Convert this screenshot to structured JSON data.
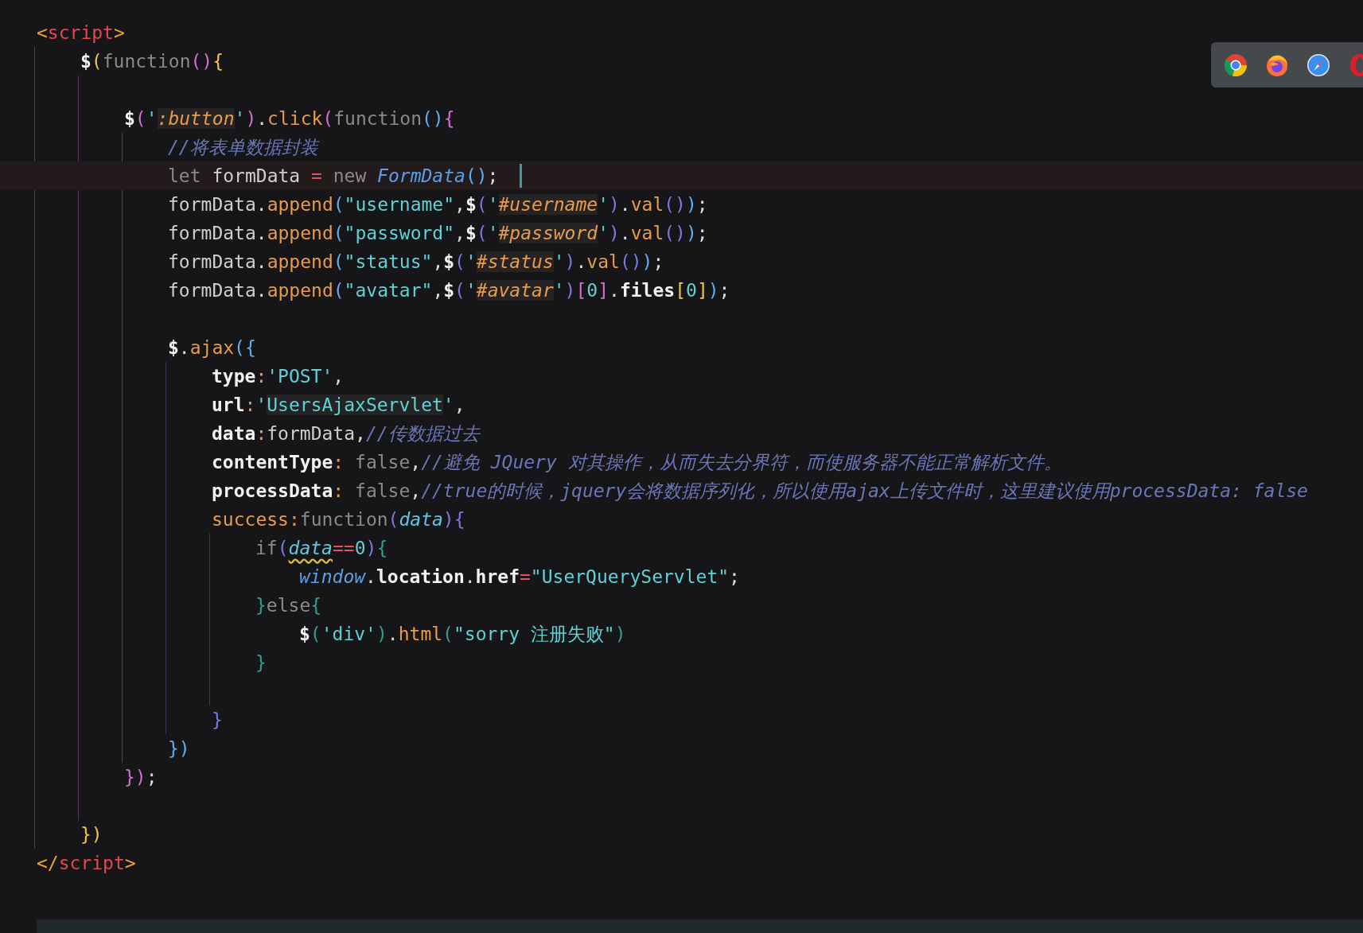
{
  "editor": {
    "lines": [
      {
        "current": false,
        "tokens": [
          {
            "text": "<",
            "kind": "angle"
          },
          {
            "text": "script",
            "kind": "tag"
          },
          {
            "text": ">",
            "kind": "angle"
          }
        ],
        "children": [
          {
            "current": false,
            "tokens": [
              {
                "text": "$",
                "kind": "dollar"
              },
              {
                "text": "(",
                "kind": "bracket",
                "color": "#f2c744"
              },
              {
                "text": "function",
                "kind": "keyword"
              },
              {
                "text": "()",
                "kind": "bracket",
                "color": "#d66ed6"
              },
              {
                "text": "{",
                "kind": "bracket",
                "color": "#f2c744"
              }
            ],
            "children": [
              {
                "current": false
              },
              {
                "current": false,
                "tokens": [
                  {
                    "text": "$",
                    "kind": "dollar"
                  },
                  {
                    "text": "(",
                    "kind": "bracket",
                    "color": "#d66ed6"
                  },
                  {
                    "text": "'",
                    "kind": "quote"
                  },
                  {
                    "text": ":button",
                    "kind": "selector"
                  },
                  {
                    "text": "'",
                    "kind": "quote"
                  },
                  {
                    "text": ")",
                    "kind": "bracket",
                    "color": "#d66ed6"
                  },
                  {
                    "text": ".",
                    "kind": "punct"
                  },
                  {
                    "text": "click",
                    "kind": "method"
                  },
                  {
                    "text": "(",
                    "kind": "bracket",
                    "color": "#d66ed6"
                  },
                  {
                    "text": "function",
                    "kind": "keyword"
                  },
                  {
                    "text": "()",
                    "kind": "bracket",
                    "color": "#5fb0f0"
                  },
                  {
                    "text": "{",
                    "kind": "bracket",
                    "color": "#d66ed6"
                  }
                ],
                "children": [
                  {
                    "current": false,
                    "tokens": [
                      {
                        "text": "//将表单数据封装",
                        "kind": "comment"
                      }
                    ]
                  },
                  {
                    "current": true,
                    "tokens": [
                      {
                        "text": "let ",
                        "kind": "keyword"
                      },
                      {
                        "text": "formData ",
                        "kind": "plain"
                      },
                      {
                        "text": "= ",
                        "kind": "operator"
                      },
                      {
                        "text": "new ",
                        "kind": "keyword"
                      },
                      {
                        "text": "FormData",
                        "kind": "class"
                      },
                      {
                        "text": "()",
                        "kind": "bracket",
                        "color": "#5fb0f0"
                      },
                      {
                        "text": ";",
                        "kind": "punct"
                      }
                    ]
                  },
                  {
                    "current": false,
                    "tokens": [
                      {
                        "text": "formData",
                        "kind": "plain"
                      },
                      {
                        "text": ".",
                        "kind": "punct"
                      },
                      {
                        "text": "append",
                        "kind": "method"
                      },
                      {
                        "text": "(",
                        "kind": "bracket",
                        "color": "#5fb0f0"
                      },
                      {
                        "text": "\"username\"",
                        "kind": "string"
                      },
                      {
                        "text": ",",
                        "kind": "punct"
                      },
                      {
                        "text": "$",
                        "kind": "dollar"
                      },
                      {
                        "text": "(",
                        "kind": "bracket",
                        "color": "#7a7ae6"
                      },
                      {
                        "text": "'",
                        "kind": "quote"
                      },
                      {
                        "text": "#username",
                        "kind": "selector"
                      },
                      {
                        "text": "'",
                        "kind": "quote"
                      },
                      {
                        "text": ")",
                        "kind": "bracket",
                        "color": "#7a7ae6"
                      },
                      {
                        "text": ".",
                        "kind": "punct"
                      },
                      {
                        "text": "val",
                        "kind": "method"
                      },
                      {
                        "text": "()",
                        "kind": "bracket",
                        "color": "#7a7ae6"
                      },
                      {
                        "text": ")",
                        "kind": "bracket",
                        "color": "#5fb0f0"
                      },
                      {
                        "text": ";",
                        "kind": "punct"
                      }
                    ]
                  },
                  {
                    "current": false,
                    "tokens": [
                      {
                        "text": "formData",
                        "kind": "plain"
                      },
                      {
                        "text": ".",
                        "kind": "punct"
                      },
                      {
                        "text": "append",
                        "kind": "method"
                      },
                      {
                        "text": "(",
                        "kind": "bracket",
                        "color": "#5fb0f0"
                      },
                      {
                        "text": "\"password\"",
                        "kind": "string"
                      },
                      {
                        "text": ",",
                        "kind": "punct"
                      },
                      {
                        "text": "$",
                        "kind": "dollar"
                      },
                      {
                        "text": "(",
                        "kind": "bracket",
                        "color": "#7a7ae6"
                      },
                      {
                        "text": "'",
                        "kind": "quote"
                      },
                      {
                        "text": "#password",
                        "kind": "selector"
                      },
                      {
                        "text": "'",
                        "kind": "quote"
                      },
                      {
                        "text": ")",
                        "kind": "bracket",
                        "color": "#7a7ae6"
                      },
                      {
                        "text": ".",
                        "kind": "punct"
                      },
                      {
                        "text": "val",
                        "kind": "method"
                      },
                      {
                        "text": "()",
                        "kind": "bracket",
                        "color": "#7a7ae6"
                      },
                      {
                        "text": ")",
                        "kind": "bracket",
                        "color": "#5fb0f0"
                      },
                      {
                        "text": ";",
                        "kind": "punct"
                      }
                    ]
                  },
                  {
                    "current": false,
                    "tokens": [
                      {
                        "text": "formData",
                        "kind": "plain"
                      },
                      {
                        "text": ".",
                        "kind": "punct"
                      },
                      {
                        "text": "append",
                        "kind": "method"
                      },
                      {
                        "text": "(",
                        "kind": "bracket",
                        "color": "#5fb0f0"
                      },
                      {
                        "text": "\"status\"",
                        "kind": "string"
                      },
                      {
                        "text": ",",
                        "kind": "punct"
                      },
                      {
                        "text": "$",
                        "kind": "dollar"
                      },
                      {
                        "text": "(",
                        "kind": "bracket",
                        "color": "#7a7ae6"
                      },
                      {
                        "text": "'",
                        "kind": "quote"
                      },
                      {
                        "text": "#status",
                        "kind": "selector"
                      },
                      {
                        "text": "'",
                        "kind": "quote"
                      },
                      {
                        "text": ")",
                        "kind": "bracket",
                        "color": "#7a7ae6"
                      },
                      {
                        "text": ".",
                        "kind": "punct"
                      },
                      {
                        "text": "val",
                        "kind": "method"
                      },
                      {
                        "text": "()",
                        "kind": "bracket",
                        "color": "#7a7ae6"
                      },
                      {
                        "text": ")",
                        "kind": "bracket",
                        "color": "#5fb0f0"
                      },
                      {
                        "text": ";",
                        "kind": "punct"
                      }
                    ]
                  },
                  {
                    "current": false,
                    "tokens": [
                      {
                        "text": "formData",
                        "kind": "plain"
                      },
                      {
                        "text": ".",
                        "kind": "punct"
                      },
                      {
                        "text": "append",
                        "kind": "method"
                      },
                      {
                        "text": "(",
                        "kind": "bracket",
                        "color": "#5fb0f0"
                      },
                      {
                        "text": "\"avatar\"",
                        "kind": "string"
                      },
                      {
                        "text": ",",
                        "kind": "punct"
                      },
                      {
                        "text": "$",
                        "kind": "dollar"
                      },
                      {
                        "text": "(",
                        "kind": "bracket",
                        "color": "#7a7ae6"
                      },
                      {
                        "text": "'",
                        "kind": "quote"
                      },
                      {
                        "text": "#avatar",
                        "kind": "selector"
                      },
                      {
                        "text": "'",
                        "kind": "quote"
                      },
                      {
                        "text": ")",
                        "kind": "bracket",
                        "color": "#7a7ae6"
                      },
                      {
                        "text": "[",
                        "kind": "bracket",
                        "color": "#d66ed6"
                      },
                      {
                        "text": "0",
                        "kind": "number"
                      },
                      {
                        "text": "]",
                        "kind": "bracket",
                        "color": "#d66ed6"
                      },
                      {
                        "text": ".",
                        "kind": "punct"
                      },
                      {
                        "text": "files",
                        "kind": "property"
                      },
                      {
                        "text": "[",
                        "kind": "bracket",
                        "color": "#f2c744"
                      },
                      {
                        "text": "0",
                        "kind": "number"
                      },
                      {
                        "text": "]",
                        "kind": "bracket",
                        "color": "#f2c744"
                      },
                      {
                        "text": ")",
                        "kind": "bracket",
                        "color": "#5fb0f0"
                      },
                      {
                        "text": ";",
                        "kind": "punct"
                      }
                    ]
                  },
                  {
                    "current": false
                  },
                  {
                    "current": false,
                    "tokens": [
                      {
                        "text": "$",
                        "kind": "dollar"
                      },
                      {
                        "text": ".",
                        "kind": "punct"
                      },
                      {
                        "text": "ajax",
                        "kind": "method"
                      },
                      {
                        "text": "(",
                        "kind": "bracket",
                        "color": "#5fb0f0"
                      },
                      {
                        "text": "{",
                        "kind": "bracket",
                        "color": "#5fb0f0"
                      }
                    ],
                    "children": [
                      {
                        "current": false,
                        "tokens": [
                          {
                            "text": "type",
                            "kind": "property"
                          },
                          {
                            "text": ":",
                            "kind": "colon"
                          },
                          {
                            "text": "'POST'",
                            "kind": "string"
                          },
                          {
                            "text": ",",
                            "kind": "punct"
                          }
                        ]
                      },
                      {
                        "current": false,
                        "tokens": [
                          {
                            "text": "url",
                            "kind": "property"
                          },
                          {
                            "text": ":",
                            "kind": "colon"
                          },
                          {
                            "text": "'",
                            "kind": "string"
                          },
                          {
                            "text": "UsersAjaxServlet",
                            "kind": "string-marked"
                          },
                          {
                            "text": "'",
                            "kind": "string"
                          },
                          {
                            "text": ",",
                            "kind": "punct"
                          }
                        ]
                      },
                      {
                        "current": false,
                        "tokens": [
                          {
                            "text": "data",
                            "kind": "property"
                          },
                          {
                            "text": ":",
                            "kind": "colon"
                          },
                          {
                            "text": "formData",
                            "kind": "plain"
                          },
                          {
                            "text": ",",
                            "kind": "punct"
                          },
                          {
                            "text": "//传数据过去",
                            "kind": "comment"
                          }
                        ]
                      },
                      {
                        "current": false,
                        "tokens": [
                          {
                            "text": "contentType",
                            "kind": "property"
                          },
                          {
                            "text": ": ",
                            "kind": "colon"
                          },
                          {
                            "text": "false",
                            "kind": "keyword"
                          },
                          {
                            "text": ",",
                            "kind": "punct"
                          },
                          {
                            "text": "//避免 JQuery 对其操作，从而失去分界符，而使服务器不能正常解析文件。",
                            "kind": "comment"
                          }
                        ]
                      },
                      {
                        "current": false,
                        "tokens": [
                          {
                            "text": "processData",
                            "kind": "property"
                          },
                          {
                            "text": ": ",
                            "kind": "colon"
                          },
                          {
                            "text": "false",
                            "kind": "keyword"
                          },
                          {
                            "text": ",",
                            "kind": "punct"
                          },
                          {
                            "text": "//true的时候，jquery会将数据序列化，所以使用ajax上传文件时，这里建议使用processData: false",
                            "kind": "comment"
                          }
                        ]
                      },
                      {
                        "current": false,
                        "tokens": [
                          {
                            "text": "success",
                            "kind": "method"
                          },
                          {
                            "text": ":",
                            "kind": "colon"
                          },
                          {
                            "text": "function",
                            "kind": "keyword"
                          },
                          {
                            "text": "(",
                            "kind": "bracket",
                            "color": "#7a7ae6"
                          },
                          {
                            "text": "data",
                            "kind": "param"
                          },
                          {
                            "text": ")",
                            "kind": "bracket",
                            "color": "#7a7ae6"
                          },
                          {
                            "text": "{",
                            "kind": "bracket",
                            "color": "#7a7ae6"
                          }
                        ],
                        "children": [
                          {
                            "current": false,
                            "tokens": [
                              {
                                "text": "if",
                                "kind": "keyword"
                              },
                              {
                                "text": "(",
                                "kind": "bracket",
                                "color": "#7a7ae6"
                              },
                              {
                                "text": "data",
                                "kind": "warning"
                              },
                              {
                                "text": "==",
                                "kind": "operator"
                              },
                              {
                                "text": "0",
                                "kind": "number"
                              },
                              {
                                "text": ")",
                                "kind": "bracket",
                                "color": "#7a7ae6"
                              },
                              {
                                "text": "{",
                                "kind": "bracket",
                                "color": "#2fa08c"
                              }
                            ],
                            "children": [
                              {
                                "current": false,
                                "tokens": [
                                  {
                                    "text": "window",
                                    "kind": "class"
                                  },
                                  {
                                    "text": ".",
                                    "kind": "punct"
                                  },
                                  {
                                    "text": "location",
                                    "kind": "property"
                                  },
                                  {
                                    "text": ".",
                                    "kind": "punct"
                                  },
                                  {
                                    "text": "href",
                                    "kind": "property"
                                  },
                                  {
                                    "text": "=",
                                    "kind": "operator"
                                  },
                                  {
                                    "text": "\"UserQueryServlet\"",
                                    "kind": "string"
                                  },
                                  {
                                    "text": ";",
                                    "kind": "punct"
                                  }
                                ]
                              }
                            ]
                          },
                          {
                            "current": false,
                            "tokens": [
                              {
                                "text": "}",
                                "kind": "bracket",
                                "color": "#2fa08c"
                              },
                              {
                                "text": "else",
                                "kind": "keyword"
                              },
                              {
                                "text": "{",
                                "kind": "bracket",
                                "color": "#2fa08c"
                              }
                            ],
                            "children": [
                              {
                                "current": false,
                                "tokens": [
                                  {
                                    "text": "$",
                                    "kind": "dollar"
                                  },
                                  {
                                    "text": "(",
                                    "kind": "bracket",
                                    "color": "#2fa08c"
                                  },
                                  {
                                    "text": "'div'",
                                    "kind": "string"
                                  },
                                  {
                                    "text": ")",
                                    "kind": "bracket",
                                    "color": "#2fa08c"
                                  },
                                  {
                                    "text": ".",
                                    "kind": "punct"
                                  },
                                  {
                                    "text": "html",
                                    "kind": "method"
                                  },
                                  {
                                    "text": "(",
                                    "kind": "bracket",
                                    "color": "#2fa08c"
                                  },
                                  {
                                    "text": "\"sorry 注册失败\"",
                                    "kind": "string"
                                  },
                                  {
                                    "text": ")",
                                    "kind": "bracket",
                                    "color": "#2fa08c"
                                  }
                                ]
                              }
                            ]
                          },
                          {
                            "current": false,
                            "tokens": [
                              {
                                "text": "}",
                                "kind": "bracket",
                                "color": "#2fa08c"
                              }
                            ]
                          },
                          {
                            "current": false
                          }
                        ]
                      },
                      {
                        "current": false,
                        "tokens": [
                          {
                            "text": "}",
                            "kind": "bracket",
                            "color": "#7a7ae6"
                          }
                        ]
                      }
                    ]
                  },
                  {
                    "current": false,
                    "tokens": [
                      {
                        "text": "}",
                        "kind": "bracket",
                        "color": "#5fb0f0"
                      },
                      {
                        "text": ")",
                        "kind": "bracket",
                        "color": "#5fb0f0"
                      }
                    ]
                  }
                ]
              },
              {
                "current": false,
                "tokens": [
                  {
                    "text": "}",
                    "kind": "bracket",
                    "color": "#d66ed6"
                  },
                  {
                    "text": ")",
                    "kind": "bracket",
                    "color": "#d66ed6"
                  },
                  {
                    "text": ";",
                    "kind": "punct"
                  }
                ]
              },
              {
                "current": false
              }
            ]
          },
          {
            "current": false,
            "tokens": [
              {
                "text": "}",
                "kind": "bracket",
                "color": "#f2c744"
              },
              {
                "text": ")",
                "kind": "bracket",
                "color": "#f2c744"
              }
            ]
          }
        ]
      },
      {
        "current": false,
        "tokens": [
          {
            "text": "</",
            "kind": "angle"
          },
          {
            "text": "script",
            "kind": "tag"
          },
          {
            "text": ">",
            "kind": "angle"
          }
        ]
      }
    ]
  }
}
